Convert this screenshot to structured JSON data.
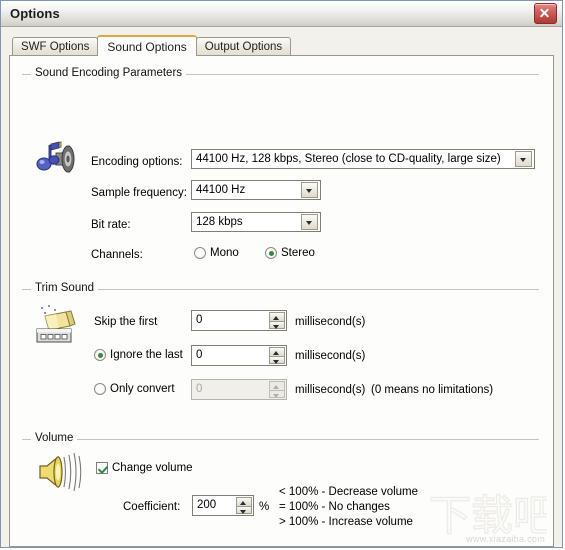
{
  "window": {
    "title": "Options",
    "close_label": "Close"
  },
  "tabs": [
    {
      "label": "SWF Options",
      "active": false
    },
    {
      "label": "Sound Options",
      "active": true
    },
    {
      "label": "Output Options",
      "active": false
    }
  ],
  "sound_encoding": {
    "group_title": "Sound Encoding Parameters",
    "icon": "music-note-speaker-icon",
    "encoding_options": {
      "label": "Encoding options:",
      "value": "44100 Hz, 128 kbps, Stereo (close to CD-quality, large size)"
    },
    "sample_frequency": {
      "label": "Sample frequency:",
      "value": "44100 Hz"
    },
    "bit_rate": {
      "label": "Bit rate:",
      "value": "128 kbps"
    },
    "channels": {
      "label": "Channels:",
      "mono_label": "Mono",
      "stereo_label": "Stereo",
      "selected": "Stereo"
    }
  },
  "trim_sound": {
    "group_title": "Trim Sound",
    "icon": "sound-trim-icon",
    "skip_first": {
      "label": "Skip the first",
      "value": "0",
      "unit": "millisecond(s)"
    },
    "ignore_last": {
      "label": "Ignore the last",
      "value": "0",
      "unit": "millisecond(s)",
      "selected": true
    },
    "only_convert": {
      "label": "Only convert",
      "value": "0",
      "unit": "millisecond(s)",
      "note": "(0 means no limitations)",
      "selected": false
    }
  },
  "volume": {
    "group_title": "Volume",
    "icon": "speaker-waves-icon",
    "change_volume": {
      "label": "Change volume",
      "checked": true
    },
    "coefficient": {
      "label": "Coefficient:",
      "value": "200",
      "unit": "%"
    },
    "hints": [
      "< 100% - Decrease volume",
      "= 100% - No changes",
      "> 100% - Increase volume"
    ]
  },
  "watermark": {
    "text": "下载吧",
    "url": "www.xiazaiba.com"
  },
  "colors": {
    "accent_tab": "#e8a33d",
    "radio_green": "#2e8b40",
    "close_red": "#bc4943"
  }
}
